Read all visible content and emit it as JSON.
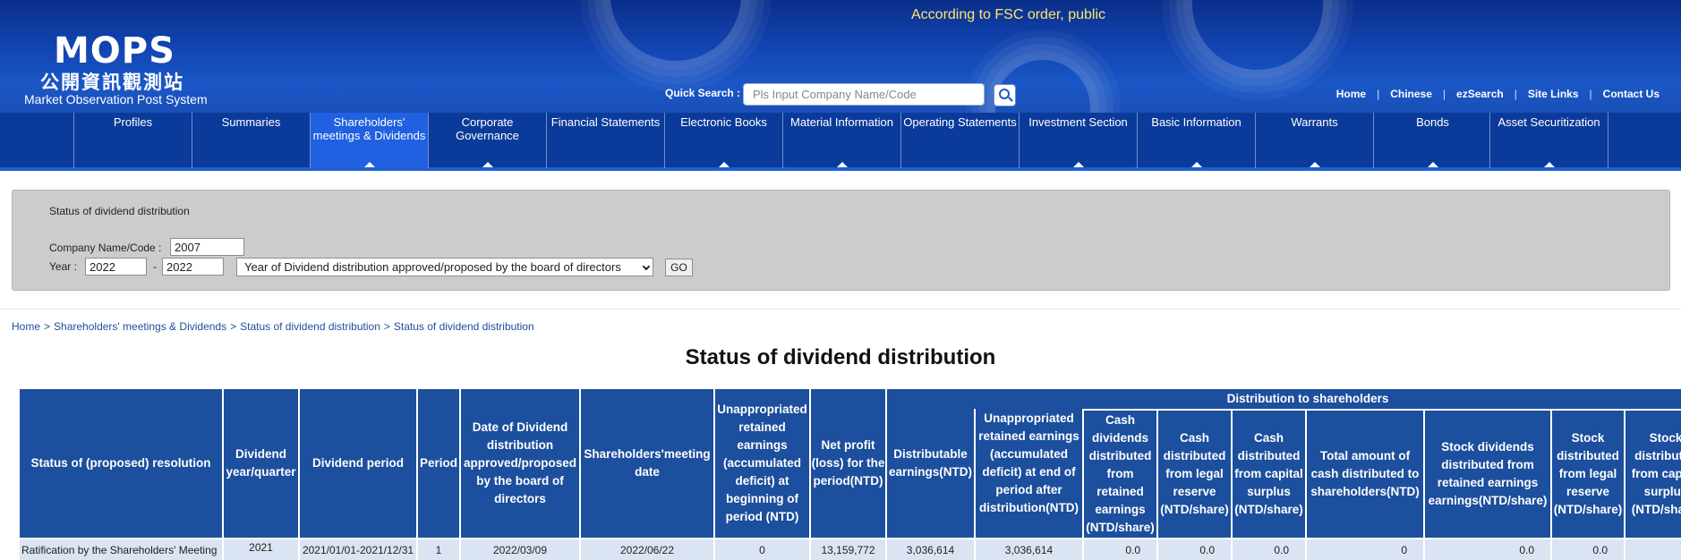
{
  "header": {
    "logo_main": "MOPS",
    "logo_zh": "公開資訊觀測站",
    "logo_sub": "Market Observation Post System",
    "notice": "According to FSC order, public",
    "quick_search_label": "Quick Search :",
    "quick_search_placeholder": "Pls Input Company Name/Code",
    "links": [
      "Home",
      "Chinese",
      "ezSearch",
      "Site Links",
      "Contact Us"
    ]
  },
  "nav": {
    "items": [
      {
        "label": "Profiles",
        "has_arrow": false
      },
      {
        "label": "Summaries",
        "has_arrow": false
      },
      {
        "label": "Shareholders' meetings & Dividends",
        "has_arrow": true,
        "active": true
      },
      {
        "label": "Corporate Governance",
        "has_arrow": true
      },
      {
        "label": "Financial Statements",
        "has_arrow": false
      },
      {
        "label": "Electronic Books",
        "has_arrow": true
      },
      {
        "label": "Material Information",
        "has_arrow": true
      },
      {
        "label": "Operating Statements",
        "has_arrow": false
      },
      {
        "label": "Investment Section",
        "has_arrow": true
      },
      {
        "label": "Basic Information",
        "has_arrow": true
      },
      {
        "label": "Warrants",
        "has_arrow": true
      },
      {
        "label": "Bonds",
        "has_arrow": true
      },
      {
        "label": "Asset Securitization",
        "has_arrow": true
      }
    ]
  },
  "search_panel": {
    "title": "Status of dividend distribution",
    "company_label": "Company Name/Code :",
    "company_value": "2007",
    "year_label": "Year :",
    "year_from": "2022",
    "year_dash": "-",
    "year_to": "2022",
    "year_type_selected": "Year of Dividend distribution approved/proposed by the board of directors",
    "go_label": "GO"
  },
  "breadcrumb": [
    "Home",
    "Shareholders' meetings & Dividends",
    "Status of dividend distribution",
    "Status of dividend distribution"
  ],
  "breadcrumb_sep": ">",
  "page_title": "Status of dividend distribution",
  "table": {
    "group_header": "Distribution to shareholders",
    "columns": [
      "Status of (proposed) resolution",
      "Dividend year/quarter",
      "Dividend period",
      "Period",
      "Date of Dividend distribution approved/proposed by the board of directors",
      "Shareholders'meeting date",
      "Unappropriated retained earnings (accumulated deficit) at beginning of period (NTD)",
      "Net profit (loss) for the period(NTD)",
      "Distributable earnings(NTD)",
      "Unappropriated retained earnings (accumulated deficit) at end of period after distribution(NTD)",
      "Cash dividends distributed from retained earnings (NTD/share)",
      "Cash distributed from legal reserve (NTD/share)",
      "Cash distributed from capital surplus (NTD/share)",
      "Total amount of cash distributed to shareholders(NTD)",
      "Stock dividends distributed from retained earnings earnings(NTD/share)",
      "Stock distributed from legal reserve (NTD/share)",
      "Stock distributed from capital surplus (NTD/share)"
    ],
    "rows": [
      [
        "Ratification by the Shareholders' Meeting",
        "2021",
        "2021/01/01-2021/12/31",
        "1",
        "2022/03/09",
        "2022/06/22",
        "0",
        "13,159,772",
        "3,036,614",
        "3,036,614",
        "0.0",
        "0.0",
        "0.0",
        "0",
        "0.0",
        "0.0",
        ""
      ]
    ]
  }
}
